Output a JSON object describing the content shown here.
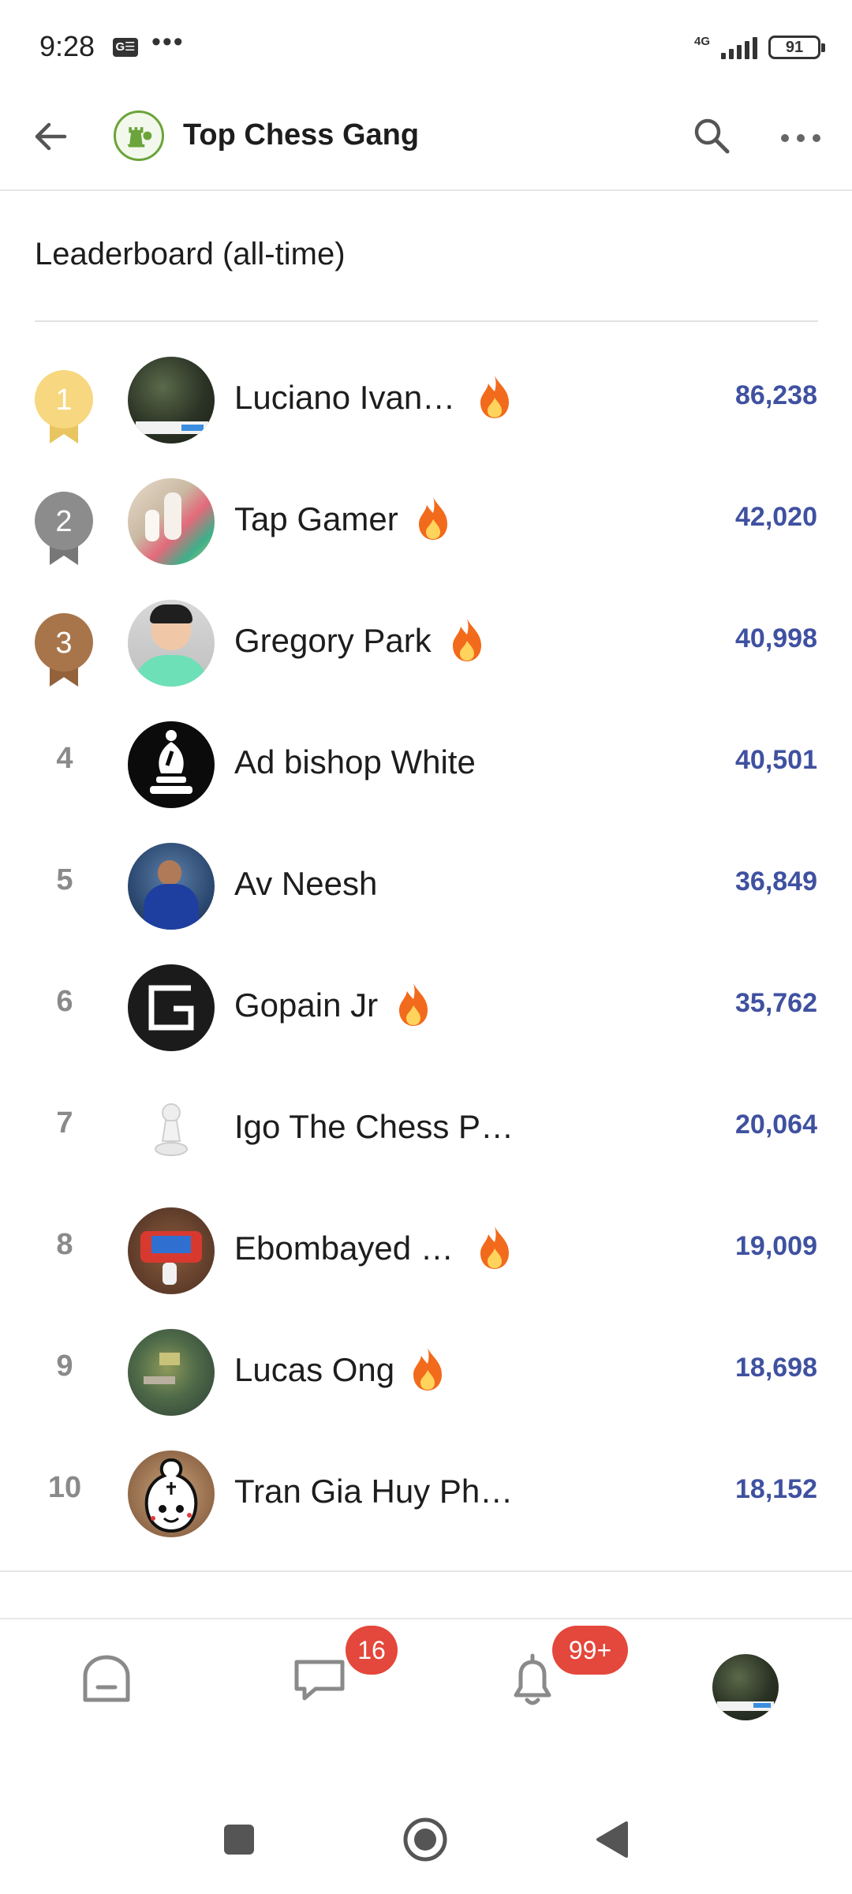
{
  "status_bar": {
    "time": "9:28",
    "left_icon_label": "G☰",
    "dots": "•••",
    "network": "4G",
    "battery": "91"
  },
  "header": {
    "group_name": "Top Chess Gang"
  },
  "leaderboard": {
    "title": "Leaderboard (all-time)",
    "rows": [
      {
        "rank": "1",
        "name": "Luciano Ivan…",
        "score": "86,238",
        "streak": true
      },
      {
        "rank": "2",
        "name": "Tap Gamer",
        "score": "42,020",
        "streak": true
      },
      {
        "rank": "3",
        "name": "Gregory Park",
        "score": "40,998",
        "streak": true
      },
      {
        "rank": "4",
        "name": "Ad bishop White",
        "score": "40,501",
        "streak": false
      },
      {
        "rank": "5",
        "name": "Av Neesh",
        "score": "36,849",
        "streak": false
      },
      {
        "rank": "6",
        "name": "Gopain Jr",
        "score": "35,762",
        "streak": true
      },
      {
        "rank": "7",
        "name": "Igo The Chess P…",
        "score": "20,064",
        "streak": false
      },
      {
        "rank": "8",
        "name": "Ebombayed …",
        "score": "19,009",
        "streak": true
      },
      {
        "rank": "9",
        "name": "Lucas Ong",
        "score": "18,698",
        "streak": true
      },
      {
        "rank": "10",
        "name": "Tran Gia Huy Ph…",
        "score": "18,152",
        "streak": false
      }
    ]
  },
  "bottom_nav": {
    "chats_badge": "16",
    "notifications_badge": "99+"
  },
  "colors": {
    "score": "#3f51a0",
    "gold": "#f7d77f",
    "silver": "#8c8c8c",
    "bronze": "#a8754a",
    "badge": "#e4473b",
    "fire": "#f26a1b"
  }
}
